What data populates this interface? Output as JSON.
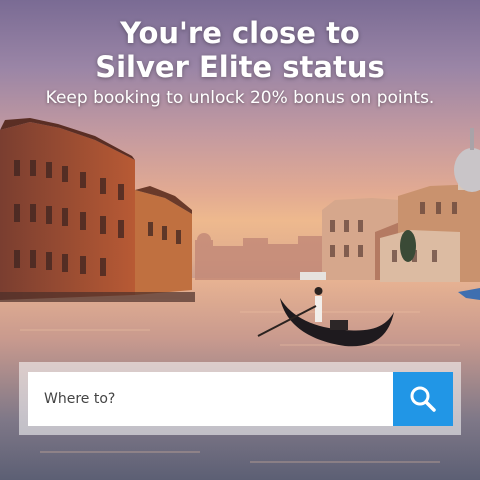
{
  "banner": {
    "headline_line1": "You're close to",
    "headline_line2": "Silver Elite status",
    "subline": "Keep booking to unlock 20% bonus on points."
  },
  "search": {
    "placeholder": "Where to?",
    "button_icon": "search-icon"
  },
  "colors": {
    "accent": "#2196e6",
    "text": "#ffffff"
  }
}
